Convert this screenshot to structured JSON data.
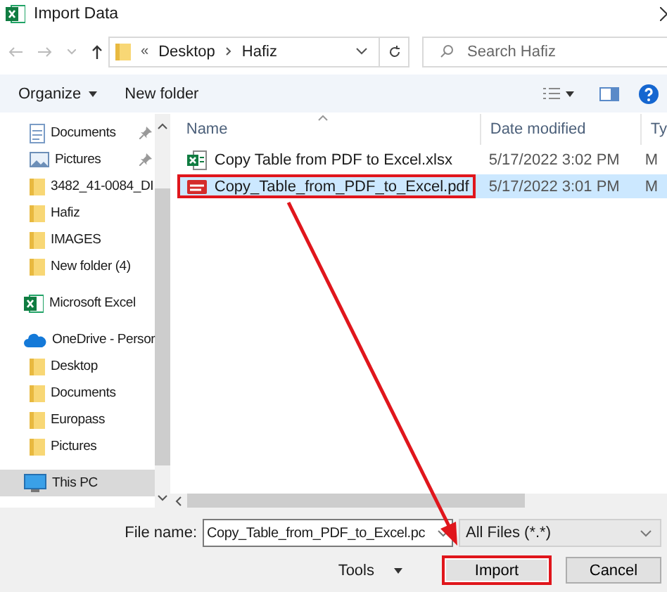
{
  "window": {
    "title": "Import Data"
  },
  "address": {
    "overflow": "«",
    "path": [
      "Desktop",
      "Hafiz"
    ]
  },
  "search": {
    "placeholder": "Search Hafiz"
  },
  "toolbar": {
    "organize": "Organize",
    "new_folder": "New folder"
  },
  "sidebar": {
    "quick_access_items": [
      {
        "label": "Documents",
        "kind": "documents",
        "pinned": true,
        "selected": false
      },
      {
        "label": "Pictures",
        "kind": "pictures",
        "pinned": true,
        "selected": false
      },
      {
        "label": "3482_41-0084_DI",
        "kind": "folder",
        "pinned": false,
        "selected": false
      },
      {
        "label": "Hafiz",
        "kind": "folder",
        "pinned": false,
        "selected": false
      },
      {
        "label": "IMAGES",
        "kind": "folder",
        "pinned": false,
        "selected": false
      },
      {
        "label": "New folder (4)",
        "kind": "folder",
        "pinned": false,
        "selected": false
      }
    ],
    "items": [
      {
        "label": "Microsoft Excel",
        "kind": "excel",
        "selected": false
      },
      {
        "label": "OneDrive - Persor",
        "kind": "onedrive",
        "selected": false,
        "children": [
          {
            "label": "Desktop",
            "kind": "folder",
            "selected": false
          },
          {
            "label": "Documents",
            "kind": "folder",
            "selected": false
          },
          {
            "label": "Europass",
            "kind": "folder",
            "selected": false
          },
          {
            "label": "Pictures",
            "kind": "folder",
            "selected": false
          }
        ]
      },
      {
        "label": "This PC",
        "kind": "pc",
        "selected": true
      }
    ]
  },
  "file_list": {
    "columns": [
      "Name",
      "Date modified",
      "Ty"
    ],
    "rows": [
      {
        "name": "Copy Table from PDF to Excel.xlsx",
        "kind": "xlsx",
        "date": "5/17/2022 3:02 PM",
        "type": "M",
        "selected": false,
        "highlighted": false
      },
      {
        "name": "Copy_Table_from_PDF_to_Excel.pdf",
        "kind": "pdf",
        "date": "5/17/2022 3:01 PM",
        "type": "M",
        "selected": true,
        "highlighted": true
      }
    ]
  },
  "footer": {
    "file_name_label": "File name:",
    "file_name": "Copy_Table_from_PDF_to_Excel.pc",
    "file_type": "All Files (*.*)",
    "tools": "Tools",
    "buttons": [
      {
        "label": "Import",
        "highlighted": true
      },
      {
        "label": "Cancel",
        "highlighted": false
      }
    ]
  },
  "annotation_arrow": true
}
